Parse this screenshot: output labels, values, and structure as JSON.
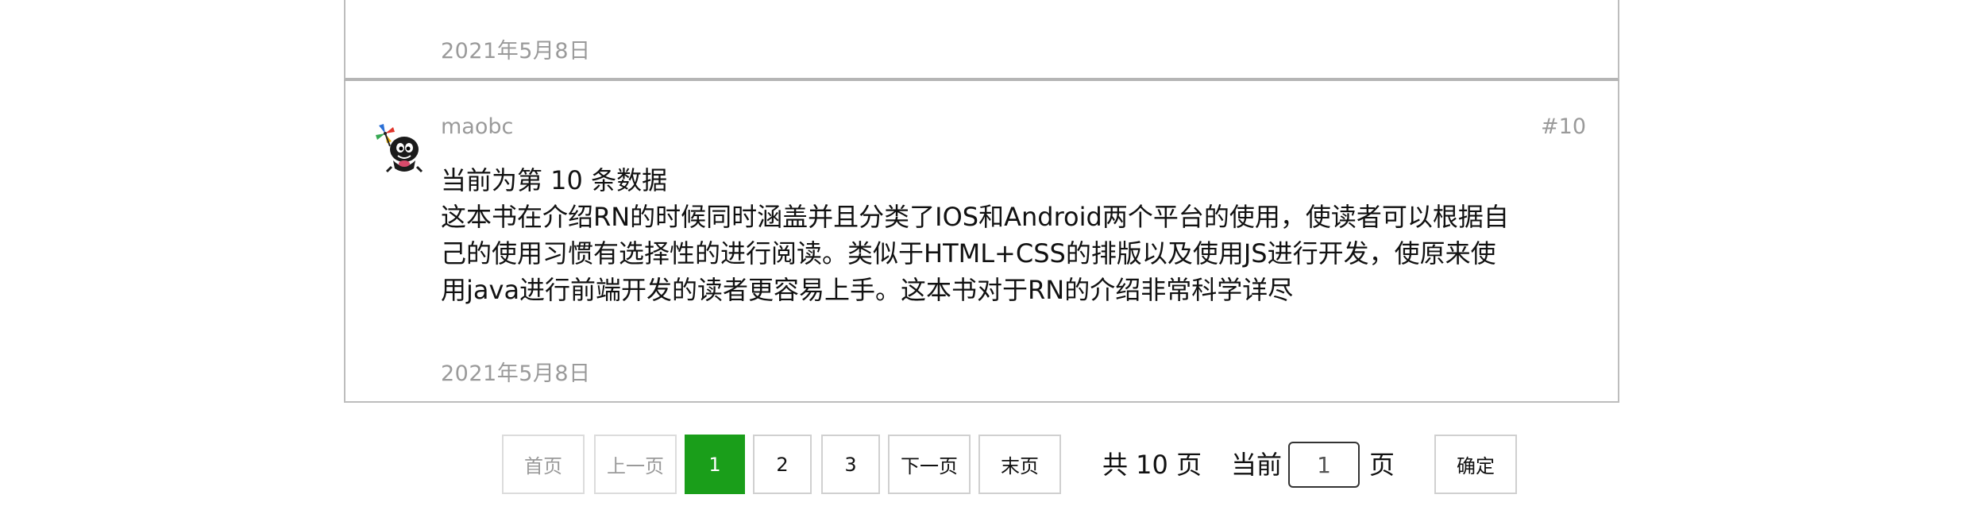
{
  "previous_comment": {
    "date": "2021年5月8日"
  },
  "comment": {
    "username": "maobc",
    "floor": "#10",
    "content_lines": [
      "当前为第 10 条数据",
      "这本书在介绍RN的时候同时涵盖并且分类了IOS和Android两个平台的使用，使读者可以根据自",
      "己的使用习惯有选择性的进行阅读。类似于HTML+CSS的排版以及使用JS进行开发，使原来使",
      "用java进行前端开发的读者更容易上手。这本书对于RN的介绍非常科学详尽"
    ],
    "date": "2021年5月8日",
    "avatar_icon": "cartoon-creature-avatar"
  },
  "pagination": {
    "first_label": "首页",
    "prev_label": "上一页",
    "pages": [
      "1",
      "2",
      "3"
    ],
    "current_page": "1",
    "next_label": "下一页",
    "last_label": "末页",
    "total_text": "共 10 页",
    "current_prefix": "当前",
    "page_input_value": "1",
    "current_suffix": "页",
    "confirm_label": "确定",
    "active_color": "#1a9e1a"
  }
}
